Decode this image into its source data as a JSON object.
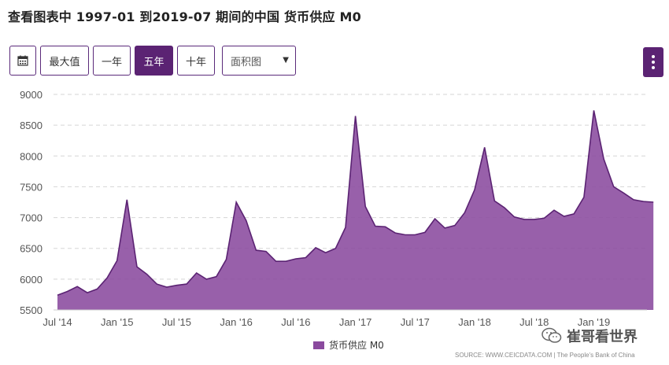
{
  "title": "查看图表中 1997-01 到2019-07 期间的中国 货币供应 M0",
  "toolbar": {
    "calendar_icon": "calendar-icon",
    "buttons": [
      "最大值",
      "一年",
      "五年",
      "十年"
    ],
    "active": "五年",
    "select_value": "面积图"
  },
  "menu_icon": "vertical-dots-icon",
  "chart_data": {
    "type": "area",
    "title": "查看图表中 1997-01 到2019-07 期间的中国 货币供应 M0",
    "ylim": [
      5500,
      9000
    ],
    "yticks": [
      5500,
      6000,
      6500,
      7000,
      7500,
      8000,
      8500,
      9000
    ],
    "xtick_labels": [
      "Jul '14",
      "Jan '15",
      "Jul '15",
      "Jan '16",
      "Jul '16",
      "Jan '17",
      "Jul '17",
      "Jan '18",
      "Jul '18",
      "Jan '19"
    ],
    "grid": true,
    "color": "#8a4a9e",
    "series": [
      {
        "name": "货币供应 M0",
        "x": [
          "2014-07",
          "2014-08",
          "2014-09",
          "2014-10",
          "2014-11",
          "2014-12",
          "2015-01",
          "2015-02",
          "2015-03",
          "2015-04",
          "2015-05",
          "2015-06",
          "2015-07",
          "2015-08",
          "2015-09",
          "2015-10",
          "2015-11",
          "2015-12",
          "2016-01",
          "2016-02",
          "2016-03",
          "2016-04",
          "2016-05",
          "2016-06",
          "2016-07",
          "2016-08",
          "2016-09",
          "2016-10",
          "2016-11",
          "2016-12",
          "2017-01",
          "2017-02",
          "2017-03",
          "2017-04",
          "2017-05",
          "2017-06",
          "2017-07",
          "2017-08",
          "2017-09",
          "2017-10",
          "2017-11",
          "2017-12",
          "2018-01",
          "2018-02",
          "2018-03",
          "2018-04",
          "2018-05",
          "2018-06",
          "2018-07",
          "2018-08",
          "2018-09",
          "2018-10",
          "2018-11",
          "2018-12",
          "2019-01",
          "2019-02",
          "2019-03",
          "2019-04",
          "2019-05",
          "2019-06",
          "2019-07"
        ],
        "values": [
          5740,
          5800,
          5880,
          5780,
          5840,
          6020,
          6300,
          7290,
          6200,
          6080,
          5920,
          5870,
          5900,
          5920,
          6100,
          6000,
          6040,
          6320,
          7250,
          6950,
          6470,
          6450,
          6290,
          6290,
          6330,
          6350,
          6510,
          6430,
          6500,
          6840,
          8650,
          7180,
          6860,
          6850,
          6750,
          6720,
          6720,
          6760,
          6980,
          6830,
          6870,
          7080,
          7450,
          8140,
          7270,
          7160,
          7010,
          6970,
          6970,
          6990,
          7120,
          7020,
          7060,
          7330,
          8740,
          7950,
          7500,
          7400,
          7290,
          7260,
          7250
        ]
      }
    ],
    "legend": "bottom-center"
  },
  "legend_label": "货币供应 M0",
  "source": "SOURCE: WWW.CEICDATA.COM | The People's Bank of China",
  "watermark_text": "崔哥看世界"
}
